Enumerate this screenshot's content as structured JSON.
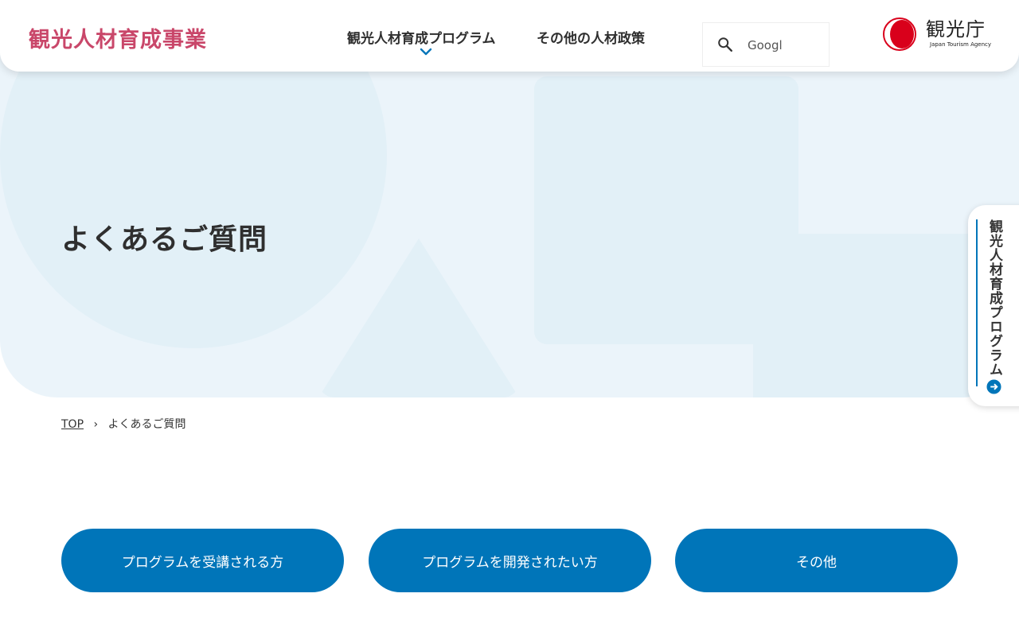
{
  "header": {
    "site_title": "観光人材育成事業",
    "nav": [
      {
        "label": "観光人材育成プログラム"
      },
      {
        "label": "その他の人材政策"
      }
    ],
    "search": {
      "placeholder": "Googl",
      "icon": "search-icon"
    },
    "agency": {
      "name": "観光庁",
      "sub": "Japan Tourism Agency"
    }
  },
  "hero": {
    "title": "よくあるご質問"
  },
  "side_tab": {
    "label": "観光人材育成プログラム",
    "icon": "arrow-right-circle-icon"
  },
  "breadcrumb": {
    "home": "TOP",
    "current": "よくあるご質問"
  },
  "categories": [
    {
      "label": "プログラムを受講される方"
    },
    {
      "label": "プログラムを開発されたい方"
    },
    {
      "label": "その他"
    }
  ],
  "colors": {
    "brand_pink": "#c9476a",
    "accent_blue": "#0075b9",
    "hero_bg": "#ebf4fa",
    "agency_red": "#d9001b"
  }
}
